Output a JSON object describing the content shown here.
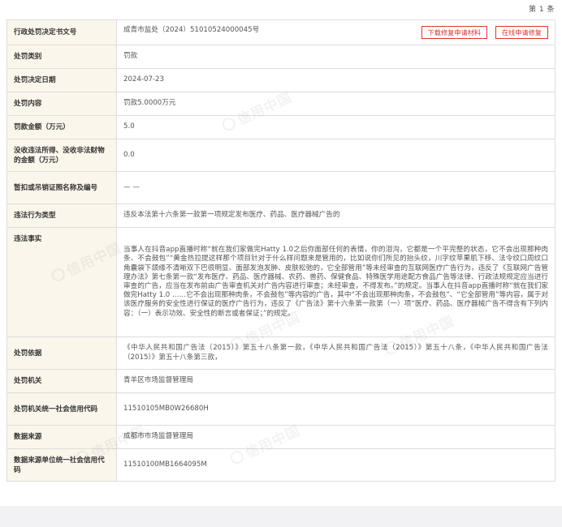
{
  "counter": "第 1 条",
  "watermark": "信用中国",
  "actions": {
    "download": "下载修复申请材料",
    "apply": "在线申请修复"
  },
  "rows": [
    {
      "label": "行政处罚决定书文号",
      "value": "成青市监处（2024）51010524000045号"
    },
    {
      "label": "处罚类别",
      "value": "罚款"
    },
    {
      "label": "处罚决定日期",
      "value": "2024-07-23"
    },
    {
      "label": "处罚内容",
      "value": "罚款5.0000万元"
    },
    {
      "label": "罚款金额（万元）",
      "value": "5.0"
    },
    {
      "label": "没收违法所得、没收非法财物的金额（万元）",
      "value": "0.0"
    },
    {
      "label": "暂扣或吊销证照名称及编号",
      "value": "— —"
    },
    {
      "label": "违法行为类型",
      "value": "违反本法第十六条第一款第一项规定发布医疗、药品、医疗器械广告的"
    },
    {
      "label": "违法事实",
      "value": "当事人在抖音app直播时称“就在我们家做完Hatty 1.0之后你面部任何的表情，你的泪沟，它都是一个平完整的状态，它不会出现那种肉条、不会鼓包”“黄金热拉提这样那个项目针对于什么样问题来是管用的，比如说你们所见的抬头纹，川字纹苹果肌下移、法令纹口周纹口角囊袋下颌缘不清晰双下巴很明显、面部发泡发肿、皮肤松弛的，它全部管用”等未经审查的互联网医疗广告行为，违反了《互联网广告管理办法》第七条第一款“发布医疗、药品、医疗器械、农药、兽药、保健食品、特殊医学用途配方食品广告等法律、行政法规规定应当进行审查的广告，应当在发布前由广告审查机关对广告内容进行审查；未经审查，不得发布。”的规定。当事人在抖音app直播时称“就在我们家做完Hatty 1.0 ……它不会出现那种肉条，不会鼓包”等内容的广告，其中“不会出现那种肉条，不会鼓包”、“它全部管用”等内容，属于对该医疗服务的安全性进行保证的医疗广告行为，违反了《广告法》第十六条第一款第（一）项“医疗、药品、医疗器械广告不得含有下列内容：（一）表示功效、安全性的断言或者保证；”的规定。"
    },
    {
      "label": "处罚依据",
      "value": "《中华人民共和国广告法（2015）》第五十八条第一款，《中华人民共和国广告法（2015）》第五十八条，《中华人民共和国广告法（2015）》第五十八条第三款，"
    },
    {
      "label": "处罚机关",
      "value": "青羊区市场监督管理局"
    },
    {
      "label": "处罚机关统一社会信用代码",
      "value": "11510105MB0W26680H"
    },
    {
      "label": "数据来源",
      "value": "成都市市场监督管理局"
    },
    {
      "label": "数据来源单位统一社会信用代码",
      "value": "11510100MB1664095M"
    }
  ]
}
